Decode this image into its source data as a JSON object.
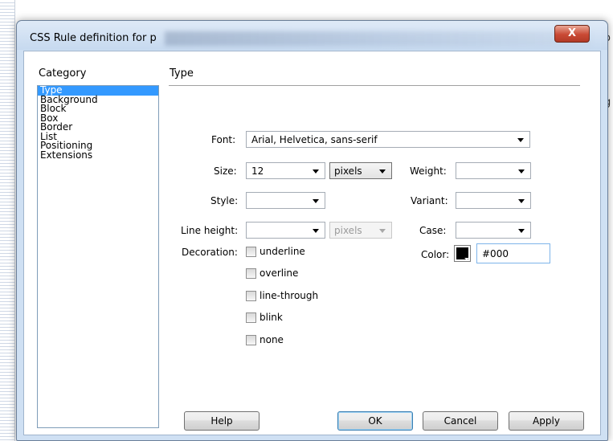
{
  "window": {
    "title": "CSS Rule definition for p",
    "close_label": "X"
  },
  "background_text": {
    "right_fragment_1": "o",
    "right_fragment_2": "g"
  },
  "category": {
    "label": "Category",
    "items": [
      "Type",
      "Background",
      "Block",
      "Box",
      "Border",
      "List",
      "Positioning",
      "Extensions"
    ],
    "selected": "Type"
  },
  "panel": {
    "heading": "Type",
    "font": {
      "label": "Font:",
      "value": "Arial, Helvetica, sans-serif"
    },
    "size": {
      "label": "Size:",
      "value": "12",
      "unit": "pixels"
    },
    "weight": {
      "label": "Weight:",
      "value": ""
    },
    "style": {
      "label": "Style:",
      "value": ""
    },
    "variant": {
      "label": "Variant:",
      "value": ""
    },
    "line_height": {
      "label": "Line height:",
      "value": "",
      "unit": "pixels"
    },
    "case": {
      "label": "Case:",
      "value": ""
    },
    "decoration": {
      "label": "Decoration:",
      "options": [
        "underline",
        "overline",
        "line-through",
        "blink",
        "none"
      ]
    },
    "color": {
      "label": "Color:",
      "value": "#000",
      "swatch": "#000000"
    }
  },
  "buttons": {
    "help": "Help",
    "ok": "OK",
    "cancel": "Cancel",
    "apply": "Apply"
  }
}
